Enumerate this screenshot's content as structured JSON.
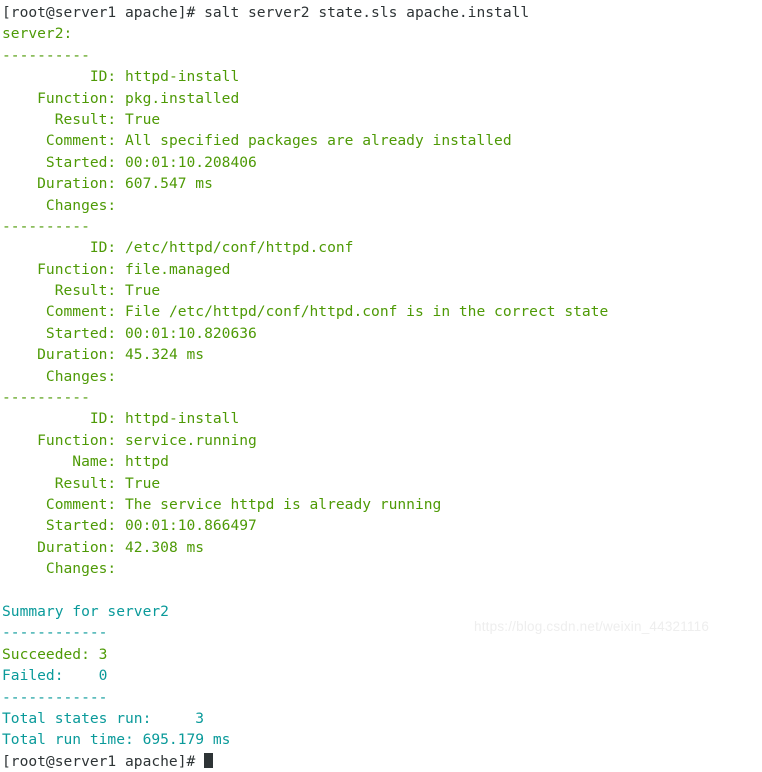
{
  "terminal": {
    "background_color": "#ffffff",
    "prompt_color": "#2e3436",
    "green_color": "#4e9a06",
    "teal_color": "#0a9a9a",
    "command_line": {
      "prompt": "[root@server1 apache]# ",
      "command": "salt server2 state.sls apache.install"
    },
    "minion_header": "server2:",
    "block_separator": "----------",
    "summary_separator": "------------",
    "blocks": [
      {
        "id_label": "          ID: ",
        "id_value": "httpd-install",
        "function_label": "    Function: ",
        "function_value": "pkg.installed",
        "name_label": "",
        "name_value": "",
        "result_label": "      Result: ",
        "result_value": "True",
        "comment_label": "     Comment: ",
        "comment_value": "All specified packages are already installed",
        "started_label": "     Started: ",
        "started_value": "00:01:10.208406",
        "duration_label": "    Duration: ",
        "duration_value": "607.547 ms",
        "changes_label": "     Changes: "
      },
      {
        "id_label": "          ID: ",
        "id_value": "/etc/httpd/conf/httpd.conf",
        "function_label": "    Function: ",
        "function_value": "file.managed",
        "name_label": "",
        "name_value": "",
        "result_label": "      Result: ",
        "result_value": "True",
        "comment_label": "     Comment: ",
        "comment_value": "File /etc/httpd/conf/httpd.conf is in the correct state",
        "started_label": "     Started: ",
        "started_value": "00:01:10.820636",
        "duration_label": "    Duration: ",
        "duration_value": "45.324 ms",
        "changes_label": "     Changes: "
      },
      {
        "id_label": "          ID: ",
        "id_value": "httpd-install",
        "function_label": "    Function: ",
        "function_value": "service.running",
        "name_label": "        Name: ",
        "name_value": "httpd",
        "result_label": "      Result: ",
        "result_value": "True",
        "comment_label": "     Comment: ",
        "comment_value": "The service httpd is already running",
        "started_label": "     Started: ",
        "started_value": "00:01:10.866497",
        "duration_label": "    Duration: ",
        "duration_value": "42.308 ms",
        "changes_label": "     Changes: "
      }
    ],
    "summary": {
      "title": "Summary for server2",
      "succeeded": "Succeeded: 3",
      "failed": "Failed:    0",
      "total_states": "Total states run:     3",
      "total_time": "Total run time: 695.179 ms"
    },
    "final_prompt": "[root@server1 apache]# "
  },
  "watermark": {
    "text": "https://blog.csdn.net/weixin_44321116"
  }
}
